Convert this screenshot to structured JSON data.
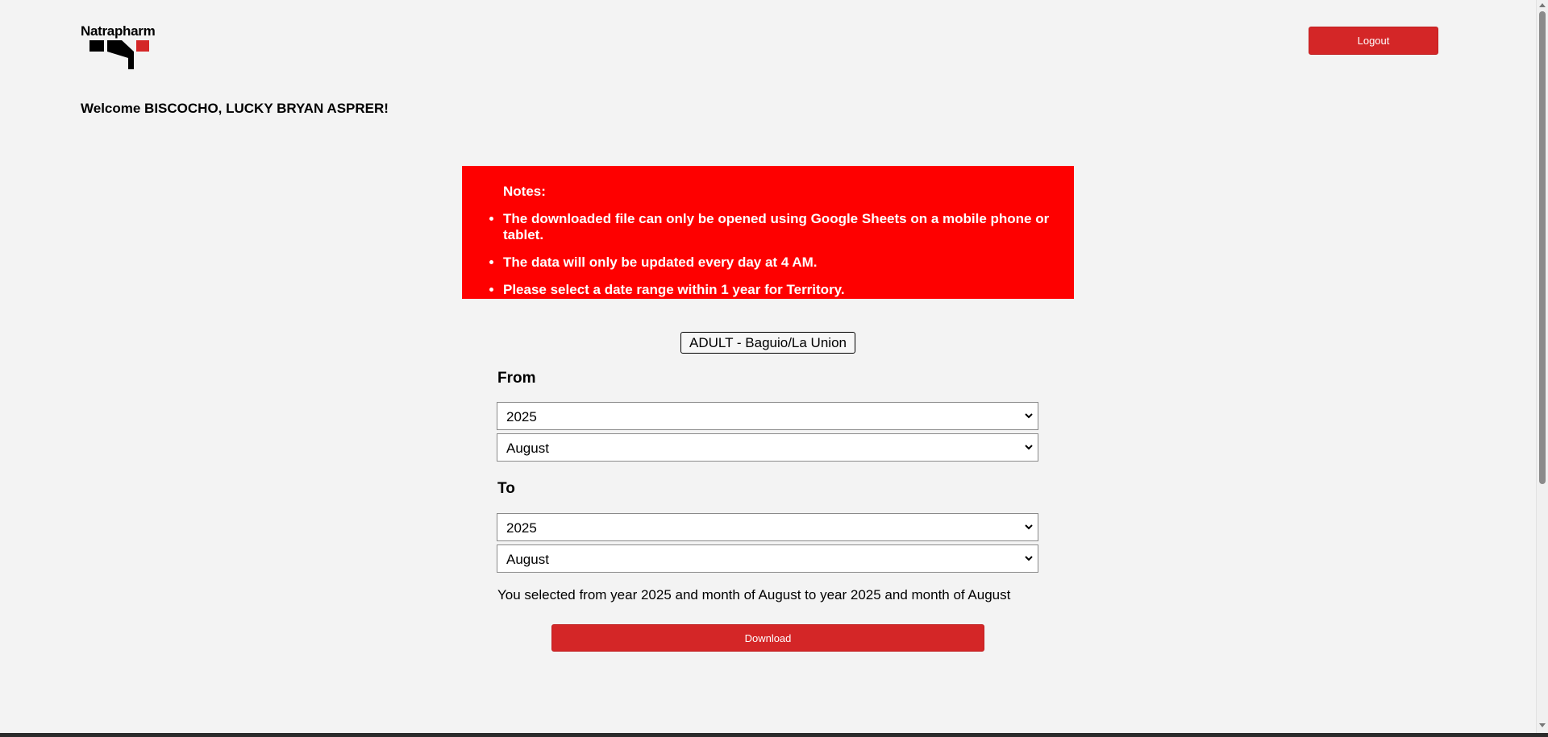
{
  "brand": {
    "name": "Natrapharm",
    "colors": {
      "dark": "#000000",
      "accent": "#d42627"
    }
  },
  "header": {
    "logout_label": "Logout",
    "welcome_text": "Welcome BISCOCHO, LUCKY BRYAN ASPRER!"
  },
  "notes": {
    "title": "Notes:",
    "items": [
      "The downloaded file can only be opened using Google Sheets on a mobile phone or tablet.",
      "The data will only be updated every day at 4 AM.",
      "Please select a date range within 1 year for Territory."
    ],
    "background_color": "#fe0000"
  },
  "territory": {
    "label": "ADULT - Baguio/La Union"
  },
  "from": {
    "label": "From",
    "year": "2025",
    "month": "August"
  },
  "to": {
    "label": "To",
    "year": "2025",
    "month": "August"
  },
  "summary": "You selected from year 2025 and month of August to year 2025 and month of August",
  "download_label": "Download",
  "icons": {
    "select_arrow": "chevron-down-icon"
  }
}
